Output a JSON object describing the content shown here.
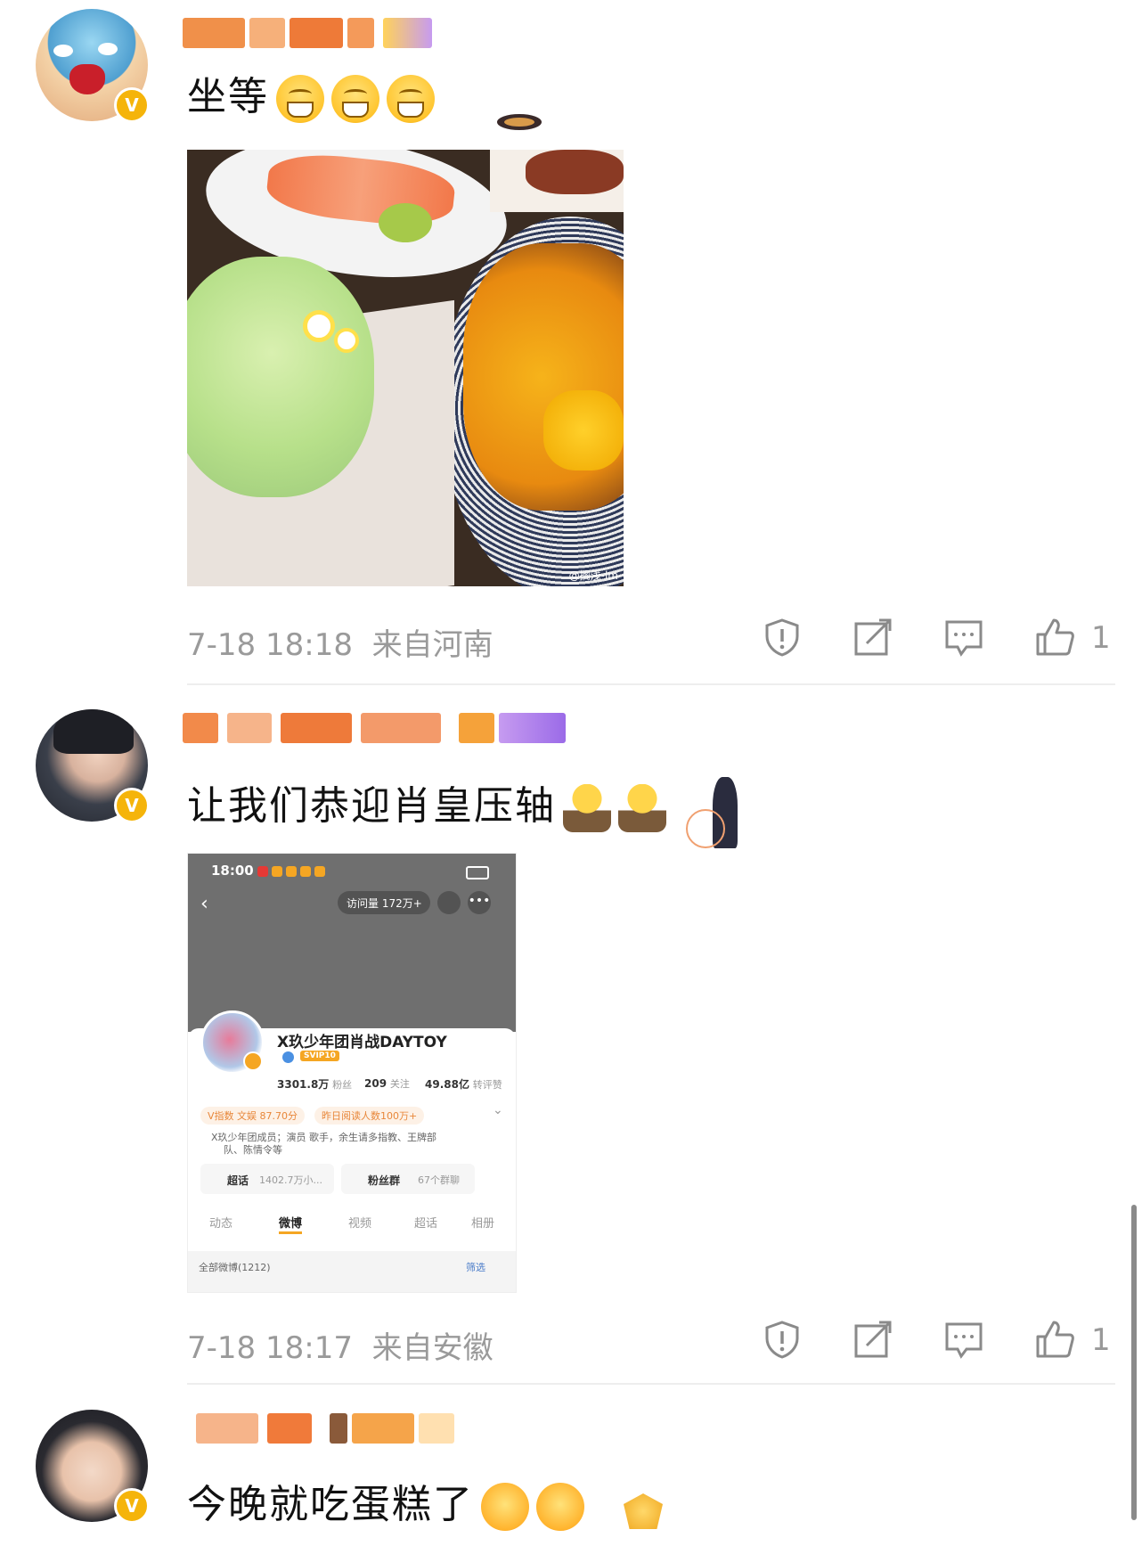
{
  "comments": [
    {
      "text": "坐等",
      "emoji_names": [
        "grin-emoji",
        "grin-emoji",
        "grin-emoji"
      ],
      "time": "7-18 18:18",
      "location": "来自河南",
      "likes": "1",
      "image": {
        "watermark": "@搁浅-lm"
      }
    },
    {
      "text": "让我们恭迎肖皇压轴",
      "emoji_names": [
        "bow-emoji",
        "bow-emoji"
      ],
      "time": "7-18 18:17",
      "location": "来自安徽",
      "likes": "1",
      "screenshot": {
        "status_time": "18:00",
        "visits": "访问量 172万+",
        "profile_name": "X玖少年团肖战DAYTOY",
        "svip": "SVIP10",
        "followers_num": "3301.8万",
        "followers_label": "粉丝",
        "following_num": "209",
        "following_label": "关注",
        "reposts_num": "49.88亿",
        "reposts_label": "转评赞",
        "tag_vindex": "V指数 文娱 87.70分",
        "tag_reads": "昨日阅读人数100万+",
        "bio_line1": "X玖少年团成员；演员 歌手，余生请多指教、王牌部",
        "bio_line2": "队、陈情令等",
        "supertopic_label": "超话",
        "supertopic_count": "1402.7万小...",
        "fangroup_label": "粉丝群",
        "fangroup_count": "67个群聊",
        "tabs": [
          "动态",
          "微博",
          "视频",
          "超话",
          "相册"
        ],
        "all_posts": "全部微博(1212)",
        "filter": "筛选"
      }
    },
    {
      "text": "今晚就吃蛋糕了",
      "emoji_names": [
        "laugh-emoji",
        "laugh-emoji"
      ]
    }
  ]
}
